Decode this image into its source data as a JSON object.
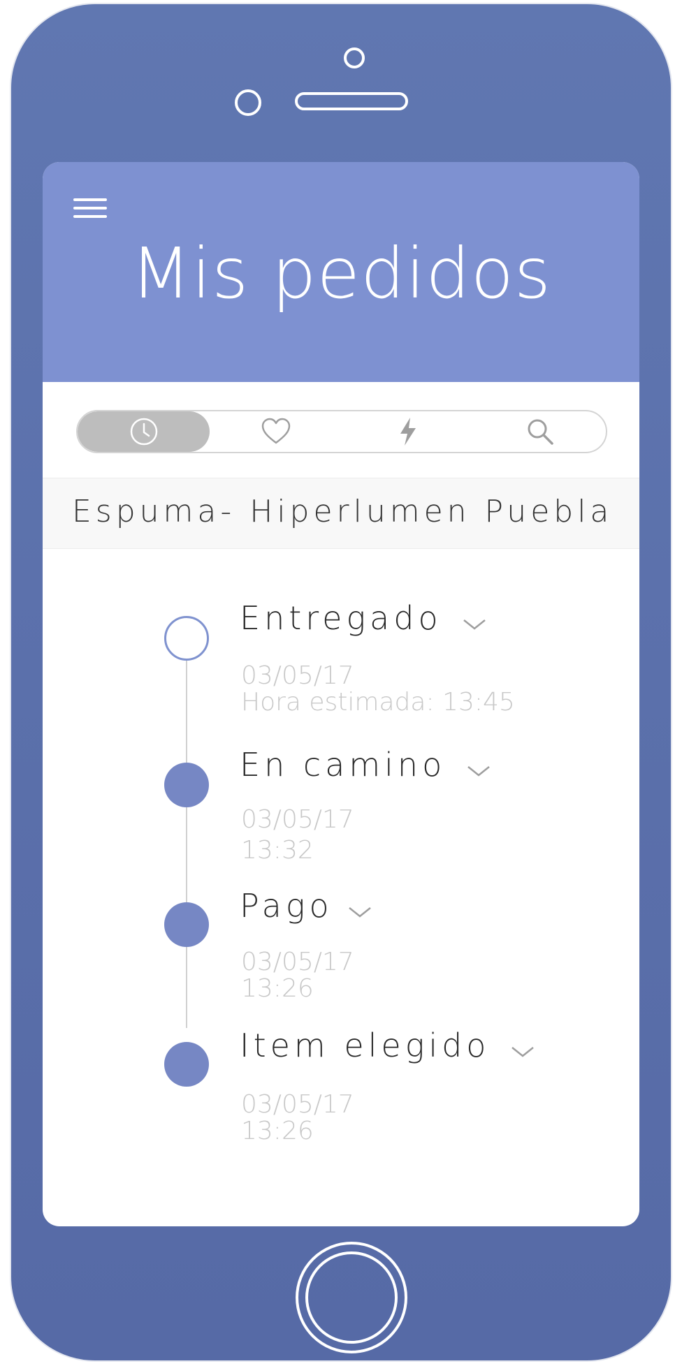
{
  "header": {
    "title": "Mis pedidos"
  },
  "tabs": [
    {
      "icon": "clock-icon",
      "active": true
    },
    {
      "icon": "heart-icon",
      "active": false
    },
    {
      "icon": "lightning-icon",
      "active": false
    },
    {
      "icon": "search-icon",
      "active": false
    }
  ],
  "store": {
    "name": "Espuma- Hiperlumen Puebla"
  },
  "timeline": [
    {
      "status": "Entregado",
      "date": "03/05/17",
      "time": "Hora estimada: 13:45",
      "state": "pending"
    },
    {
      "status": "En camino",
      "date": "03/05/17",
      "time": "13:32",
      "state": "done"
    },
    {
      "status": "Pago",
      "date": "03/05/17",
      "time": "13:26",
      "state": "done"
    },
    {
      "status": "Item elegido",
      "date": "03/05/17",
      "time": "13:26",
      "state": "done"
    }
  ],
  "colors": {
    "phone_body": "#5b70ab",
    "header_bg": "#7e91d1",
    "dot_fill": "#7687c4",
    "active_tab": "#bdbdbd"
  }
}
